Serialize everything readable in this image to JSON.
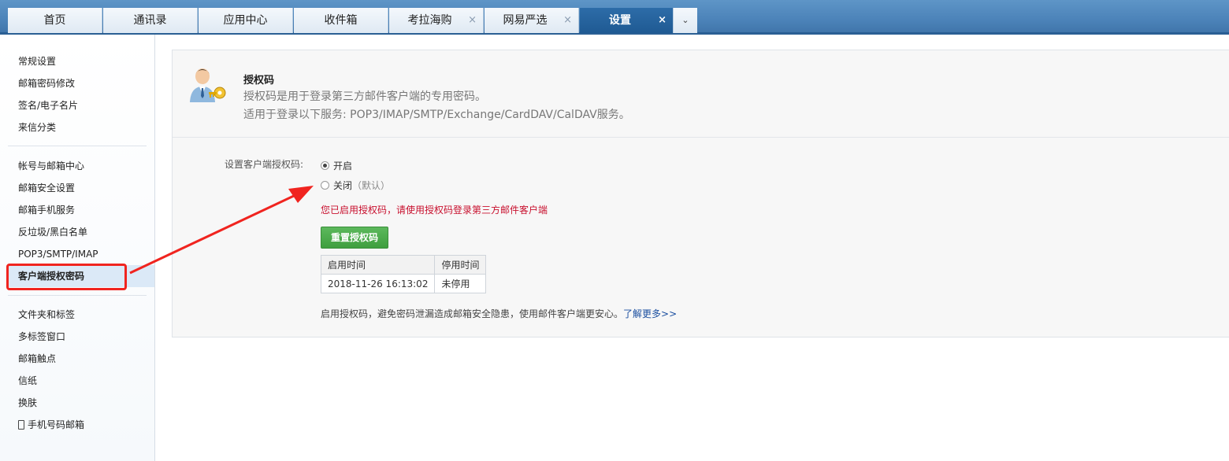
{
  "tabs": [
    {
      "label": "首页",
      "closable": false,
      "active": false
    },
    {
      "label": "通讯录",
      "closable": false,
      "active": false
    },
    {
      "label": "应用中心",
      "closable": false,
      "active": false
    },
    {
      "label": "收件箱",
      "closable": false,
      "active": false
    },
    {
      "label": "考拉海购",
      "closable": true,
      "active": false
    },
    {
      "label": "网易严选",
      "closable": true,
      "active": false
    },
    {
      "label": "设置",
      "closable": true,
      "active": true
    }
  ],
  "tab_close_glyph": "×",
  "tab_more_glyph": "⌄",
  "sidebar": {
    "group1": [
      "常规设置",
      "邮箱密码修改",
      "签名/电子名片",
      "来信分类"
    ],
    "group2": [
      "帐号与邮箱中心",
      "邮箱安全设置",
      "邮箱手机服务",
      "反垃圾/黑白名单",
      "POP3/SMTP/IMAP",
      "客户端授权密码"
    ],
    "group3": [
      "文件夹和标签",
      "多标签窗口",
      "邮箱触点",
      "信纸",
      "换肤",
      "手机号码邮箱"
    ],
    "active": "客户端授权密码"
  },
  "panel": {
    "title": "授权码",
    "desc1": "授权码是用于登录第三方邮件客户端的专用密码。",
    "desc2": "适用于登录以下服务: POP3/IMAP/SMTP/Exchange/CardDAV/CalDAV服务。",
    "form_label": "设置客户端授权码:",
    "radio_on": "开启",
    "radio_off": "关闭",
    "radio_off_hint": "（默认）",
    "selected": "开启",
    "warning": "您已启用授权码，请使用授权码登录第三方邮件客户端",
    "reset_button": "重置授权码",
    "table_headers": [
      "启用时间",
      "停用时间"
    ],
    "table_rows": [
      [
        "2018-11-26 16:13:02",
        "未停用"
      ]
    ],
    "footer_text": "启用授权码，避免密码泄漏造成邮箱安全隐患，使用邮件客户端更安心。",
    "footer_link": "了解更多>>"
  },
  "colors": {
    "active_tab": "#1f5a93",
    "warning": "#c8102e",
    "button_green": "#4cae4c",
    "annotation_red": "#f0241f",
    "link": "#1b4fa0"
  }
}
